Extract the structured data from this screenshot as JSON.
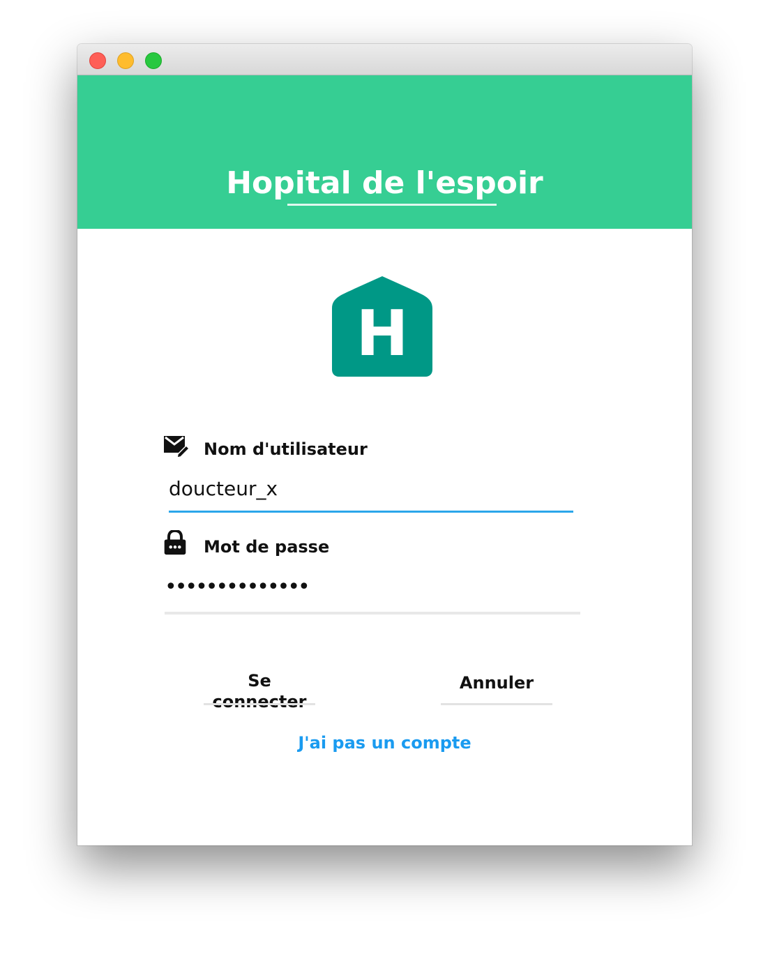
{
  "window": {
    "buttons": {
      "close": "close-button",
      "minimize": "minimize-button",
      "maximize": "maximize-button"
    }
  },
  "header": {
    "title": "Hopital de l'espoir",
    "background_color": "#36ce93"
  },
  "logo": {
    "letter": "H",
    "color": "#009886"
  },
  "form": {
    "username": {
      "icon": "mail-edit-icon",
      "label": "Nom d'utilisateur",
      "value": "doucteur_x",
      "underline_color": "#2aa6ea"
    },
    "password": {
      "icon": "lock-icon",
      "label": "Mot de passe",
      "value": "••••••••••••••",
      "underline_color": "#e8e8e8"
    }
  },
  "actions": {
    "login_label": "Se connecter",
    "cancel_label": "Annuler",
    "no_account_link": "J'ai pas un compte",
    "link_color": "#1a9bf0"
  }
}
